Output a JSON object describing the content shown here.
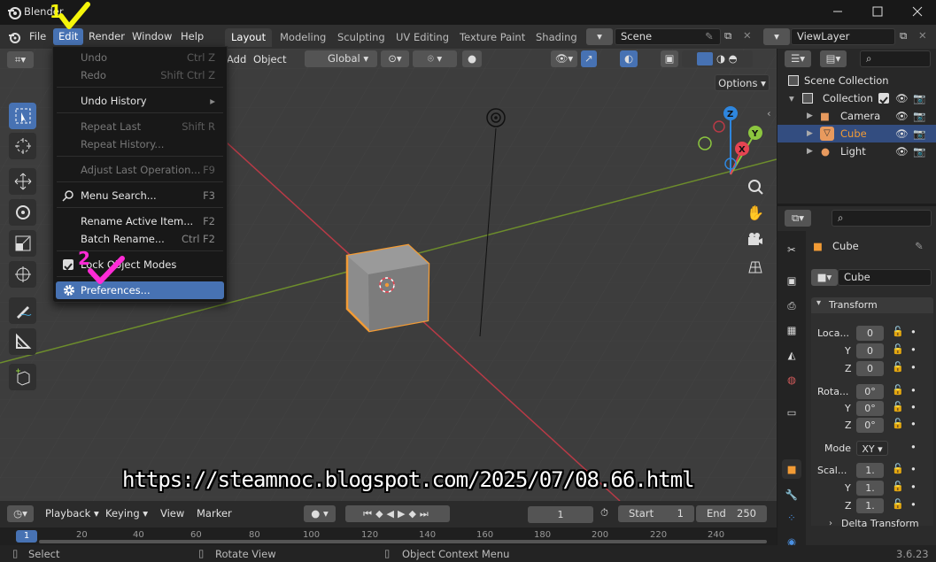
{
  "window": {
    "title": "Blender"
  },
  "menubar": {
    "items": [
      "File",
      "Edit",
      "Render",
      "Window",
      "Help"
    ]
  },
  "workspaces": [
    "Layout",
    "Modeling",
    "Sculpting",
    "UV Editing",
    "Texture Paint",
    "Shading"
  ],
  "scene": {
    "name": "Scene"
  },
  "view_layer": {
    "name": "ViewLayer"
  },
  "viewport_header": {
    "add": "Add",
    "object": "Object",
    "orientation": "Global",
    "options": "Options"
  },
  "edit_menu": [
    {
      "label": "Undo",
      "shortcut": "Ctrl Z",
      "enabled": false
    },
    {
      "label": "Redo",
      "shortcut": "Shift Ctrl Z",
      "enabled": false
    },
    {
      "label": "Undo History",
      "shortcut": "▸",
      "enabled": true
    },
    {
      "label": "Repeat Last",
      "shortcut": "Shift R",
      "enabled": false
    },
    {
      "label": "Repeat History...",
      "shortcut": "",
      "enabled": false
    },
    {
      "label": "Adjust Last Operation...",
      "shortcut": "F9",
      "enabled": false
    },
    {
      "label": "Menu Search...",
      "shortcut": "F3",
      "enabled": true
    },
    {
      "label": "Rename Active Item...",
      "shortcut": "F2",
      "enabled": true
    },
    {
      "label": "Batch Rename...",
      "shortcut": "Ctrl F2",
      "enabled": true
    },
    {
      "label": "Lock Object Modes",
      "shortcut": "",
      "enabled": true,
      "checked": true
    },
    {
      "label": "Preferences...",
      "shortcut": "",
      "enabled": true,
      "highlighted": true
    }
  ],
  "annotations": {
    "step1": "1",
    "step2": "2",
    "check_color": "#f5f50a",
    "check2_color": "#ff2bd6"
  },
  "outliner": {
    "root": "Scene Collection",
    "collection": "Collection",
    "items": [
      {
        "name": "Camera",
        "selected": false
      },
      {
        "name": "Cube",
        "selected": true
      },
      {
        "name": "Light",
        "selected": false
      }
    ]
  },
  "properties": {
    "object_name": "Cube",
    "data_name": "Cube",
    "panel_transform": "Transform",
    "location_label": "Loca...",
    "rotation_label": "Rota...",
    "scale_label": "Scal...",
    "axis": [
      "Y",
      "Z"
    ],
    "location": [
      "0",
      "0",
      "0"
    ],
    "rotation": [
      "0°",
      "0°",
      "0°"
    ],
    "mode_label": "Mode",
    "mode_value": "XY",
    "scale": [
      "1.",
      "1.",
      "1."
    ],
    "delta_transform": "Delta Transform"
  },
  "timeline": {
    "playback": "Playback",
    "keying": "Keying",
    "view": "View",
    "marker": "Marker",
    "current_frame": "1",
    "start_label": "Start",
    "start": "1",
    "end_label": "End",
    "end": "250",
    "ticks": [
      "1",
      "20",
      "40",
      "60",
      "80",
      "100",
      "120",
      "140",
      "160",
      "180",
      "200",
      "220",
      "240"
    ]
  },
  "statusbar": {
    "select": "Select",
    "rotate_view": "Rotate View",
    "context_menu": "Object Context Menu",
    "version": "3.6.23"
  },
  "watermark": "https://steamnoc.blogspot.com/2025/07/08.66.html",
  "colors": {
    "accent": "#4772b3",
    "selection_orange": "#f29b35",
    "x_axis": "#e54452",
    "y_axis": "#8cc63f",
    "z_axis": "#2e86de"
  }
}
